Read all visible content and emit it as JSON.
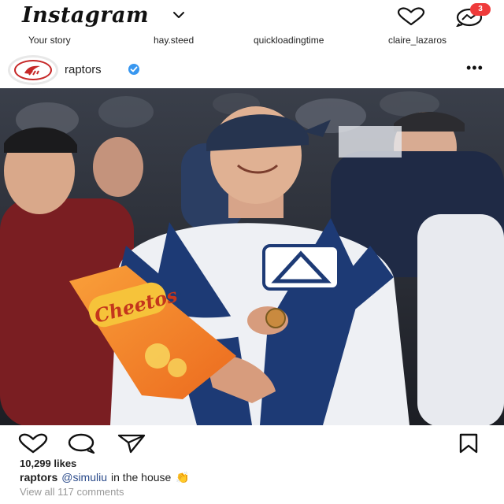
{
  "app": {
    "title": "Instagram",
    "notification_count": "3"
  },
  "stories": [
    {
      "label": "Your story"
    },
    {
      "label": "hay.steed"
    },
    {
      "label": "quickloadingtime"
    },
    {
      "label": "claire_lazaros"
    }
  ],
  "post": {
    "username": "raptors",
    "verified": true,
    "more_label": "•••",
    "likes": "10,299 likes",
    "caption_user": "raptors",
    "caption_handle": "@simuliu",
    "caption_text": "in the house",
    "caption_emoji": "👏",
    "view_comments": "View all 117 comments",
    "image_bag_brand": "Cheetos"
  },
  "icons": {
    "heart": "heart-icon",
    "comment": "comment-icon",
    "share": "share-icon",
    "save": "bookmark-icon",
    "messenger": "messenger-icon",
    "chevron": "chevron-down-icon",
    "verified": "verified-badge-icon"
  },
  "colors": {
    "accent_blue": "#3897f0",
    "badge_red": "#ef3b3b",
    "raptors_red": "#c62828"
  }
}
